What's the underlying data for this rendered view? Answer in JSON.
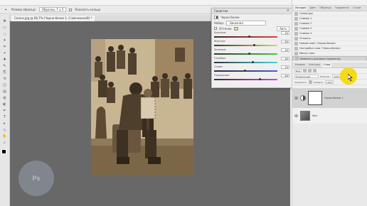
{
  "options_bar": {
    "left_label": "Размер образца:",
    "sample_label": "Образец: Т о 5",
    "show_ring_label": "Показать кольцо"
  },
  "document_tab": {
    "label": "Cereos.jpg @ 66,7% (Черно-белое 1, Слой-маска/8) *"
  },
  "toolbar": {
    "tools": [
      "move-icon",
      "marquee-icon",
      "lasso-icon",
      "magic-wand-icon",
      "crop-icon",
      "eyedropper-icon",
      "healing-icon",
      "brush-icon",
      "stamp-icon",
      "history-brush-icon",
      "eraser-icon",
      "gradient-icon",
      "blur-icon",
      "dodge-icon",
      "pen-icon",
      "type-icon",
      "path-select-icon",
      "shape-icon",
      "hand-icon",
      "zoom-icon"
    ]
  },
  "properties_panel": {
    "title": "Свойства",
    "subtitle": "Черно-белое",
    "preset_label": "Набор:",
    "preset_value": "Заказная",
    "tint_label": "Оттенок",
    "auto_label": "Авто",
    "sliders": [
      {
        "label": "Красные:",
        "value": "40",
        "pos": 0.55
      },
      {
        "label": "Желтые:",
        "value": "60",
        "pos": 0.62
      },
      {
        "label": "Зеленые:",
        "value": "40",
        "pos": 0.55
      },
      {
        "label": "Голубые:",
        "value": "60",
        "pos": 0.6
      },
      {
        "label": "Синие:",
        "value": "20",
        "pos": 0.48
      },
      {
        "label": "Пурпурные:",
        "value": "80",
        "pos": 0.72
      }
    ]
  },
  "history_panel": {
    "tabs": [
      "История",
      "Цвет",
      "Образцы",
      "Градиенты",
      "Стили"
    ],
    "items": [
      "Cereos.jpg",
      "Снимок 1",
      "Снимок 2",
      "Снимок 3",
      "Снимок 4",
      "Открыть",
      "Новый слой: «Черно-белое»",
      "Настройка слоя «Черно-белое»",
      "Маска слоя",
      "Изменить размеры параметры"
    ]
  },
  "layers_panel": {
    "tabs": [
      "Каналы",
      "Контуры",
      "Слои"
    ],
    "kind_label": "Вид",
    "blend_mode": "Нормальный",
    "opacity_label": "Непрозр.:",
    "opacity_value": "100%",
    "lock_label": "Закрепить:",
    "fill_label": "Заливка:",
    "fill_value": "100%",
    "layers": [
      {
        "name": "Черно-белое 1",
        "selected": true
      },
      {
        "name": "Фон",
        "selected": false
      }
    ]
  },
  "logo": {
    "text": "Ps"
  },
  "colors": {
    "canvas_bg": "#686868",
    "panel_bg": "#f0f0f0",
    "pointer": "#f5d700",
    "sepia": "#b19c7a"
  }
}
